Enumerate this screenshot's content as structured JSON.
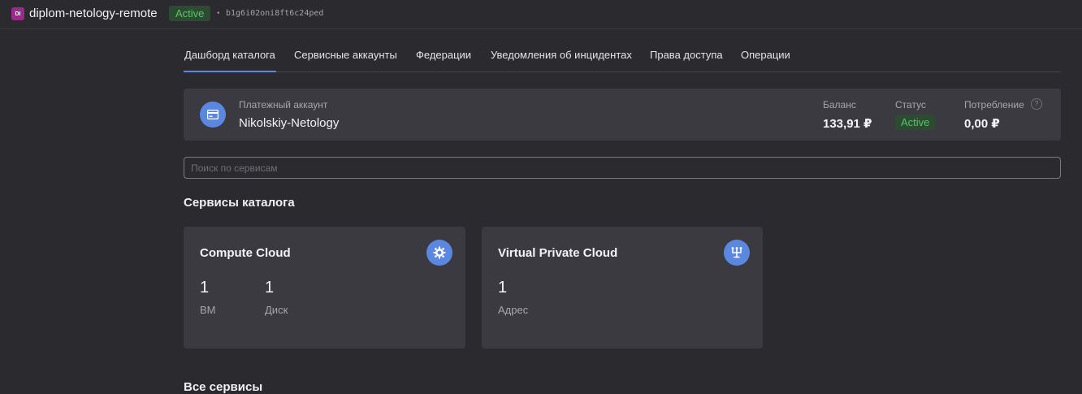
{
  "topbar": {
    "badge": "DI",
    "folder_name": "diplom-netology-remote",
    "status": "Active",
    "separator": "•",
    "folder_id": "b1g6i02oni8ft6c24ped"
  },
  "tabs": [
    {
      "label": "Дашборд каталога",
      "active": true
    },
    {
      "label": "Сервисные аккаунты"
    },
    {
      "label": "Федерации"
    },
    {
      "label": "Уведомления об инцидентах"
    },
    {
      "label": "Права доступа"
    },
    {
      "label": "Операции"
    }
  ],
  "account": {
    "label": "Платежный аккаунт",
    "name": "Nikolskiy-Netology",
    "balance_label": "Баланс",
    "balance_value": "133,91 ₽",
    "status_label": "Статус",
    "status_value": "Active",
    "consumption_label": "Потребление",
    "consumption_help": "?",
    "consumption_value": "0,00 ₽"
  },
  "search": {
    "placeholder": "Поиск по сервисам",
    "value": ""
  },
  "catalog_services": {
    "title": "Сервисы каталога",
    "cards": [
      {
        "title": "Compute Cloud",
        "icon": "compute-gear-icon",
        "metrics": [
          {
            "value": "1",
            "label": "ВМ"
          },
          {
            "value": "1",
            "label": "Диск"
          }
        ]
      },
      {
        "title": "Virtual Private Cloud",
        "icon": "network-icon",
        "metrics": [
          {
            "value": "1",
            "label": "Адрес"
          }
        ]
      }
    ]
  },
  "all_services": {
    "title": "Все сервисы"
  },
  "colors": {
    "background": "#2b2a2f",
    "card": "#3b3a41",
    "accent": "#5a87e0",
    "status_active": "#5cc46a",
    "folder_badge": "#9c2a8c"
  }
}
